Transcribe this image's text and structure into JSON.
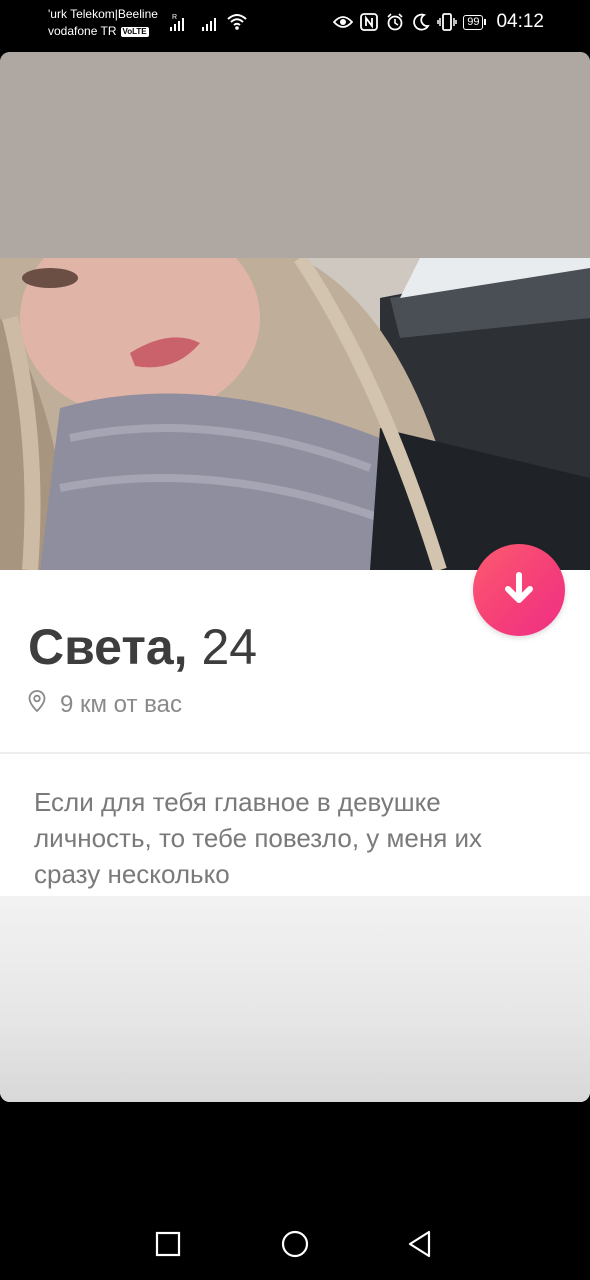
{
  "status_bar": {
    "carrier_line1": "'urk Telekom|Beeline",
    "carrier_line2": "vodafone TR",
    "volte_badge": "VoLTE",
    "roaming_indicator": "R",
    "battery_level": "99",
    "time": "04:12",
    "icons": [
      "signal-icon",
      "signal-icon",
      "wifi-icon",
      "eye-comfort-icon",
      "nfc-icon",
      "alarm-icon",
      "do-not-disturb-icon",
      "vibrate-icon",
      "battery-icon"
    ]
  },
  "profile": {
    "name": "Света,",
    "age": "24",
    "distance": "9 км от вас",
    "bio": "Если для тебя главное в девушке личность, то тебе повезло, у меня их сразу несколько"
  },
  "actions": {
    "down_button_icon": "arrow-down-icon",
    "accent_color": "#f53f78"
  },
  "nav_bar": {
    "icons": [
      "recent-apps-icon",
      "home-icon",
      "back-icon"
    ]
  }
}
